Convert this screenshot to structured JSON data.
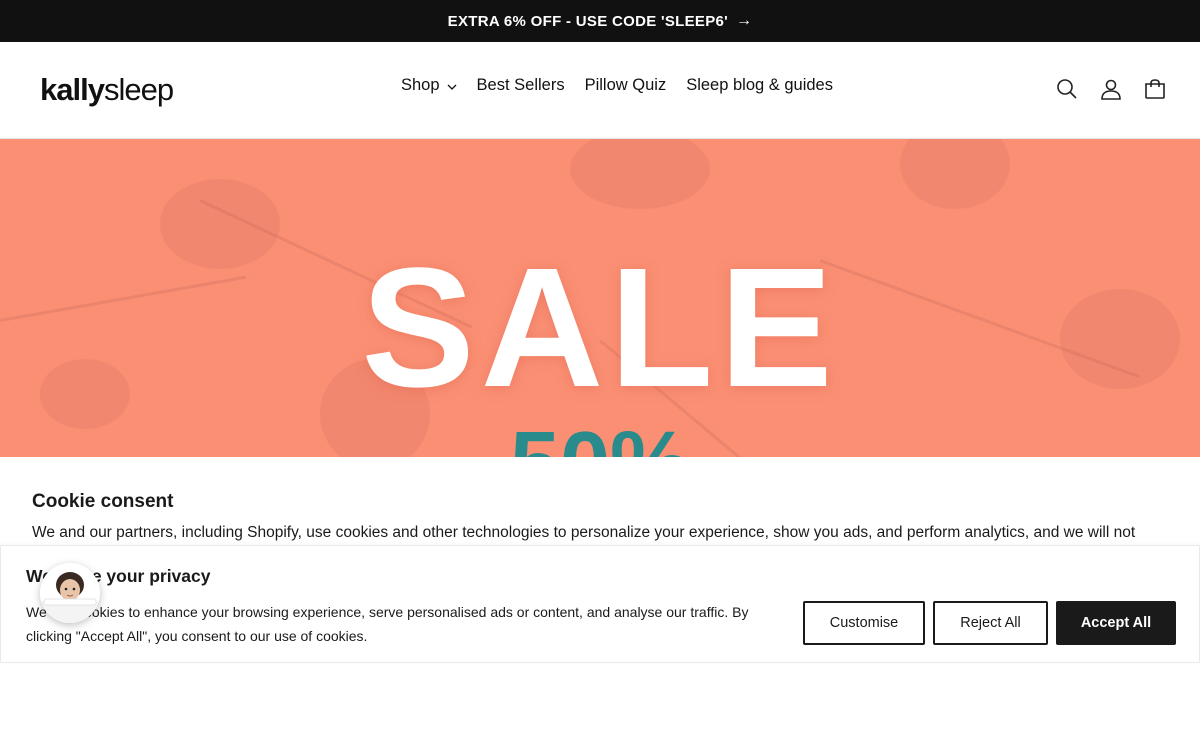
{
  "announcement": {
    "text": "EXTRA 6% OFF - USE CODE 'SLEEP6'",
    "arrow": "→"
  },
  "header": {
    "logo_bold": "kally",
    "logo_light": "sleep",
    "nav": [
      {
        "label": "Shop",
        "has_dropdown": true
      },
      {
        "label": "Best Sellers"
      },
      {
        "label": "Pillow Quiz"
      },
      {
        "label": "Sleep blog & guides"
      }
    ],
    "icons": [
      "search-icon",
      "account-icon",
      "cart-icon"
    ]
  },
  "hero": {
    "title": "SALE",
    "subtitle": "50%",
    "bg_color": "#fa8f74",
    "subtitle_color": "#2a8b8c"
  },
  "cookie_consent": {
    "title": "Cookie consent",
    "text": "We and our partners, including Shopify, use cookies and other technologies to personalize your experience, show you ads, and perform analytics, and we will not"
  },
  "privacy_banner": {
    "title": "We value your privacy",
    "text": "We use cookies to enhance your browsing experience, serve personalised ads or content, and analyse our traffic. By clicking \"Accept All\", you consent to our use of cookies.",
    "buttons": {
      "customise": "Customise",
      "reject": "Reject All",
      "accept": "Accept All"
    }
  },
  "colors": {
    "dark": "#111111",
    "accent": "#fa8f74",
    "teal": "#2a8b8c"
  }
}
